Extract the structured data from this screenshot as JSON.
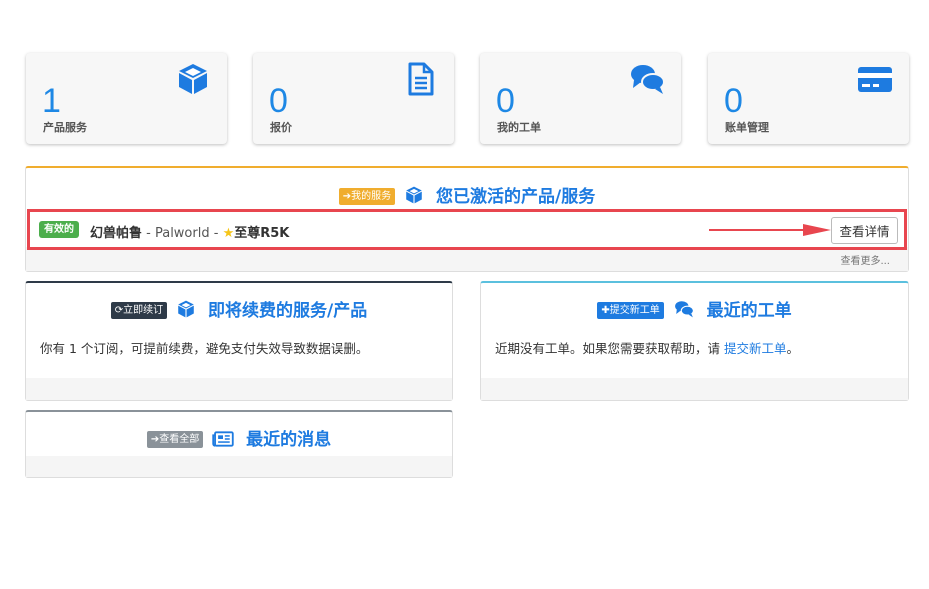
{
  "stats": [
    {
      "value": "1",
      "label": "产品服务",
      "icon": "cube-icon"
    },
    {
      "value": "0",
      "label": "报价",
      "icon": "document-icon"
    },
    {
      "value": "0",
      "label": "我的工单",
      "icon": "comments-icon"
    },
    {
      "value": "0",
      "label": "账单管理",
      "icon": "credit-card-icon"
    }
  ],
  "active_services": {
    "badge": "我的服务",
    "title": "您已激活的产品/服务",
    "status": "有效的",
    "service_name": "幻兽帕鲁",
    "service_rest": " - Palworld - ",
    "service_plan": "至尊R5K",
    "detail_button": "查看详情",
    "more_link": "查看更多..."
  },
  "renewals": {
    "badge": "立即续订",
    "title": "即将续费的服务/产品",
    "text": "你有 1 个订阅，可提前续费，避免支付失效导致数据误删。"
  },
  "tickets": {
    "badge": "提交新工单",
    "title": "最近的工单",
    "text_before": "近期没有工单。如果您需要获取帮助，请 ",
    "link": "提交新工单",
    "text_after": "。"
  },
  "news": {
    "badge": "查看全部",
    "title": "最近的消息"
  },
  "colors": {
    "accent": "#1e7be0",
    "badge_yellow": "#f0ad2e",
    "badge_dark": "#2e3a48",
    "badge_blue": "#1e7be0",
    "badge_gray": "#8a9299",
    "status_green": "#4cae4c",
    "highlight_red": "#e8464f"
  }
}
